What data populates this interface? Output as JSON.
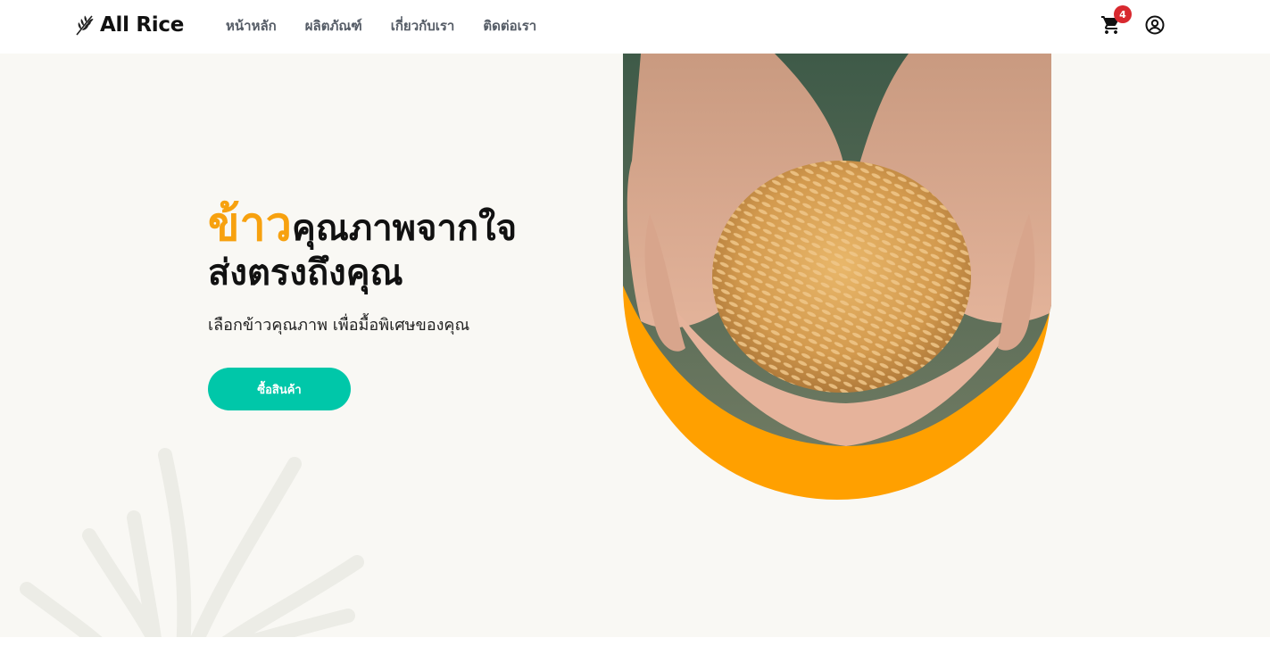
{
  "header": {
    "logo_text": "All Rice",
    "nav": [
      {
        "label": "หน้าหลัก"
      },
      {
        "label": "ผลิตภัณฑ์"
      },
      {
        "label": "เกี่ยวกับเรา"
      },
      {
        "label": "ติดต่อเรา"
      }
    ],
    "cart_count": "4",
    "cart_icon": "shopping-cart-icon",
    "account_icon": "account-circle-icon"
  },
  "hero": {
    "headline_accent": "ข้าว",
    "headline_rest_line1": "คุณภาพจากใจ",
    "headline_line2": "ส่งตรงถึงคุณ",
    "subtext": "เลือกข้าวคุณภาพ เพื่อมื้อพิเศษของคุณ",
    "cta_label": "ซื้อสินค้า",
    "image_icon": "hands-holding-rice-photo"
  },
  "colors": {
    "accent_orange": "#f7a10f",
    "cta_teal": "#00c7a9",
    "badge_red": "#d8292f",
    "hero_bg": "#f9f8f4"
  }
}
